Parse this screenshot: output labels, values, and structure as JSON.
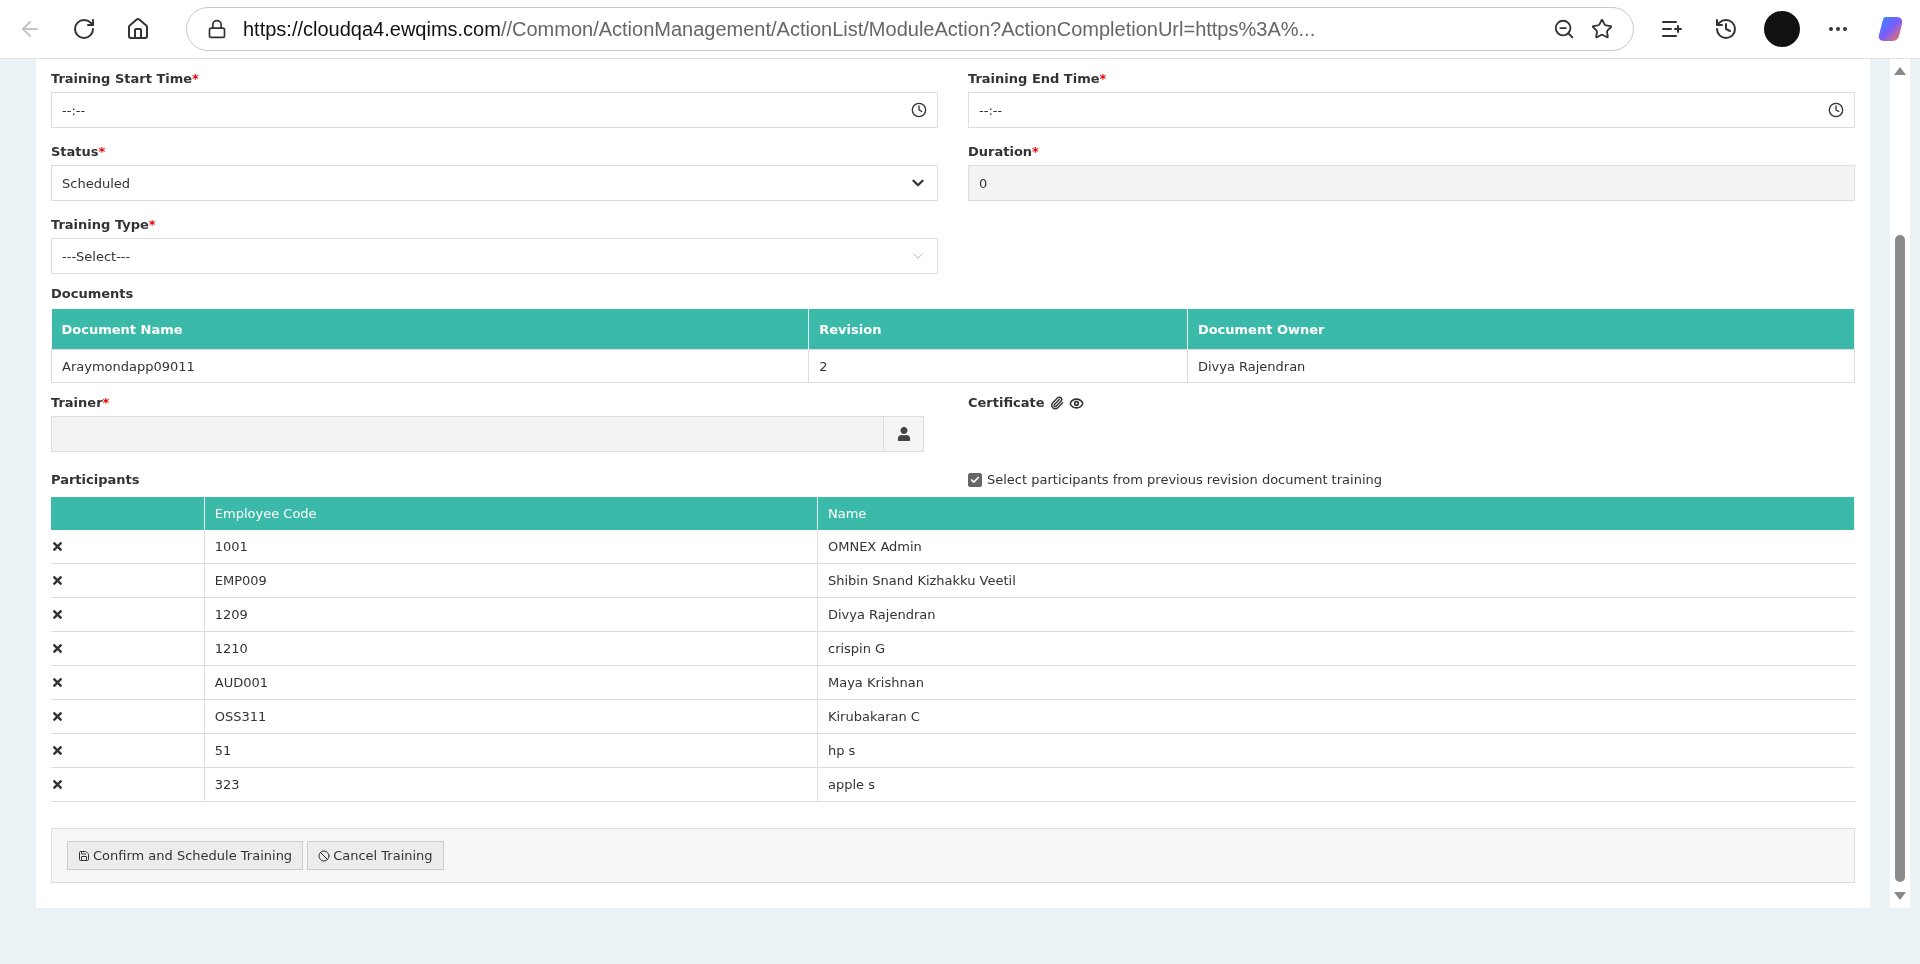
{
  "browser": {
    "url_host": "https://cloudqa4.ewqims.com",
    "url_path": "//Common/ActionManagement/ActionList/ModuleAction?ActionCompletionUrl=https%3A%...",
    "back_disabled": true
  },
  "fields": [
    {
      "kind": "time",
      "label": "Training Start Time",
      "marker": "*",
      "value": "--:--"
    },
    {
      "kind": "time",
      "label": "Training End Time",
      "marker": "*",
      "value": "--:--"
    },
    {
      "kind": "select",
      "label": "Status",
      "marker": "*",
      "value": "Scheduled"
    },
    {
      "kind": "readonly",
      "label": "Duration",
      "marker": "*",
      "value": "0"
    },
    {
      "kind": "dropdown",
      "label": "Training Type",
      "marker": "*",
      "value": "---Select---"
    }
  ],
  "documents": {
    "title": "Documents",
    "columns": [
      "Document Name",
      "Revision",
      "Document Owner"
    ],
    "rows": [
      [
        "Araymondapp09011",
        "2",
        "Divya Rajendran"
      ]
    ]
  },
  "trainer": {
    "label": "Trainer",
    "marker": "*"
  },
  "certificate": {
    "label": "Certificate"
  },
  "participants": {
    "title": "Participants",
    "option": {
      "label": "Select participants from previous revision document training",
      "checked": true
    },
    "columns": [
      "Employee Code",
      "Name"
    ],
    "rows": [
      {
        "code": "1001",
        "name": "OMNEX Admin"
      },
      {
        "code": "EMP009",
        "name": "Shibin Snand Kizhakku Veetil"
      },
      {
        "code": "1209",
        "name": "Divya Rajendran"
      },
      {
        "code": "1210",
        "name": "crispin G"
      },
      {
        "code": "AUD001",
        "name": "Maya Krishnan"
      },
      {
        "code": "OSS311",
        "name": "Kirubakaran C"
      },
      {
        "code": "51",
        "name": "hp s"
      },
      {
        "code": "323",
        "name": "apple s"
      }
    ]
  },
  "buttons": [
    {
      "label": "Confirm and Schedule Training"
    },
    {
      "label": "Cancel Training"
    }
  ]
}
